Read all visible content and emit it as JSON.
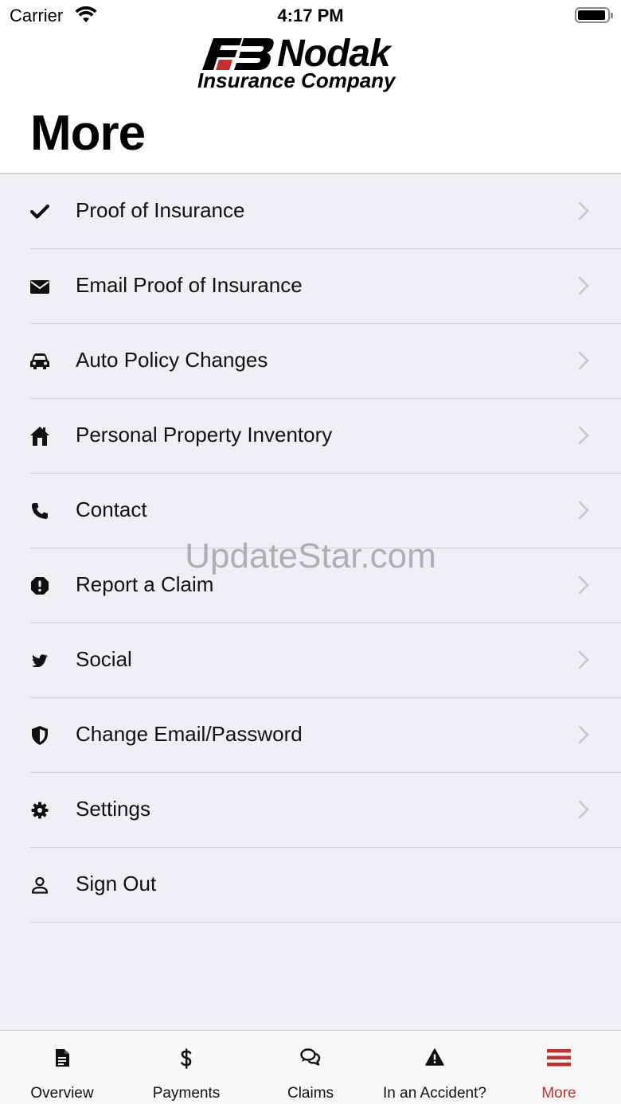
{
  "status_bar": {
    "carrier": "Carrier",
    "time": "4:17 PM",
    "wifi_icon": "wifi-icon",
    "battery_icon": "battery-icon"
  },
  "header": {
    "logo_name": "Nodak",
    "logo_sub": "Insurance Company",
    "title": "More"
  },
  "menu": {
    "items": [
      {
        "label": "Proof of Insurance",
        "icon": "checkmark-icon",
        "chevron": true
      },
      {
        "label": "Email Proof of Insurance",
        "icon": "envelope-icon",
        "chevron": true
      },
      {
        "label": "Auto Policy Changes",
        "icon": "car-icon",
        "chevron": true
      },
      {
        "label": "Personal Property Inventory",
        "icon": "house-icon",
        "chevron": true
      },
      {
        "label": "Contact",
        "icon": "phone-icon",
        "chevron": true
      },
      {
        "label": "Report a Claim",
        "icon": "alert-octagon-icon",
        "chevron": true
      },
      {
        "label": "Social",
        "icon": "twitter-icon",
        "chevron": true
      },
      {
        "label": "Change Email/Password",
        "icon": "shield-icon",
        "chevron": true
      },
      {
        "label": "Settings",
        "icon": "gear-icon",
        "chevron": true
      },
      {
        "label": "Sign Out",
        "icon": "user-icon",
        "chevron": false
      }
    ]
  },
  "watermark": "UpdateStar.com",
  "tabbar": {
    "tabs": [
      {
        "label": "Overview",
        "icon": "document-icon"
      },
      {
        "label": "Payments",
        "icon": "dollar-icon"
      },
      {
        "label": "Claims",
        "icon": "chat-bubbles-icon"
      },
      {
        "label": "In an Accident?",
        "icon": "warning-triangle-icon"
      },
      {
        "label": "More",
        "icon": "hamburger-menu-icon",
        "active": true
      }
    ]
  },
  "colors": {
    "accent": "#c9302c",
    "background": "#efeff4",
    "chevron": "#c7c7cc"
  }
}
